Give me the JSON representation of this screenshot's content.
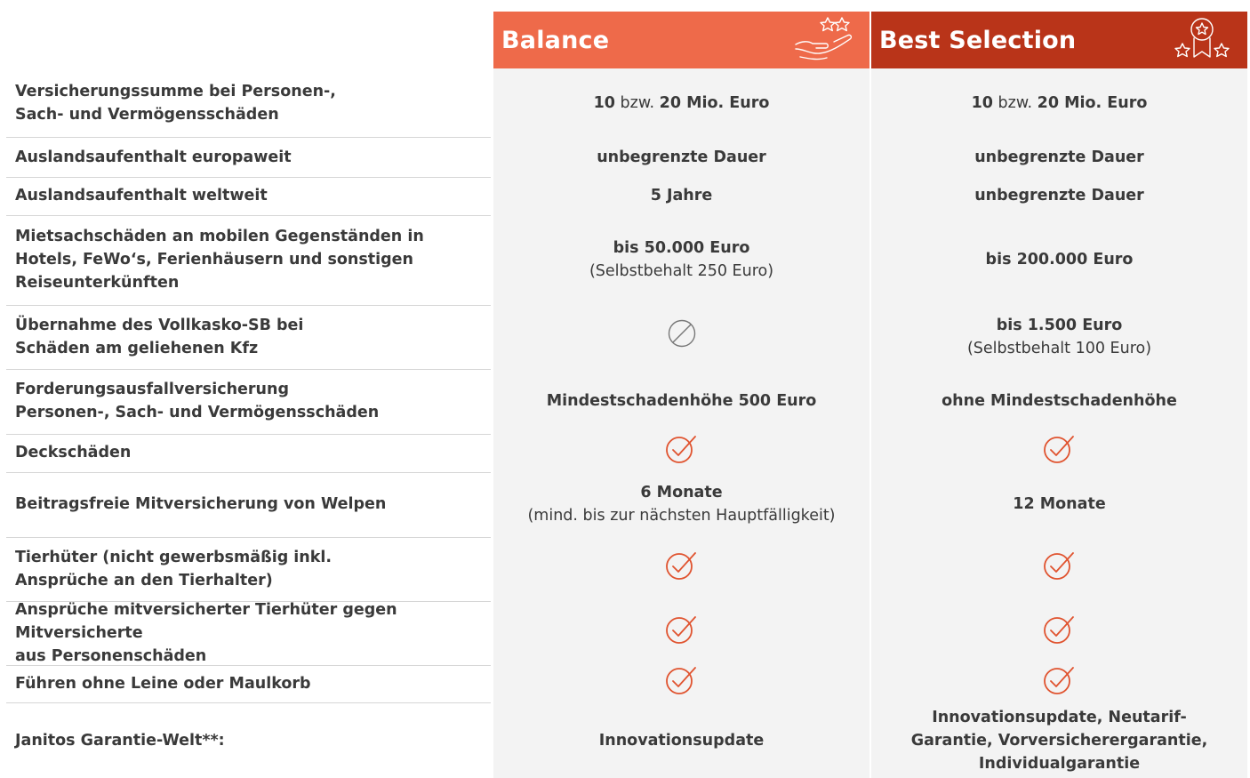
{
  "header": {
    "balance": {
      "title": "Balance",
      "color": "#ee6a4a",
      "icon": "hand-stars-icon"
    },
    "best": {
      "title": "Best Selection",
      "color": "#b93419",
      "icon": "award-stars-icon"
    }
  },
  "rows": [
    {
      "label": "Versicherungssumme bei Personen-,\nSach- und Vermögensschäden",
      "balance": {
        "n1": "10",
        "mid": " bzw. ",
        "n2": "20 Mio. Euro"
      },
      "best": {
        "n1": "10",
        "mid": " bzw. ",
        "n2": "20 Mio. Euro"
      }
    },
    {
      "label": "Auslandsaufenthalt europaweit",
      "balance": {
        "text": "unbegrenzte Dauer"
      },
      "best": {
        "text": "unbegrenzte Dauer"
      }
    },
    {
      "label": "Auslandsaufenthalt weltweit",
      "balance": {
        "text": "5 Jahre"
      },
      "best": {
        "text": "unbegrenzte Dauer"
      }
    },
    {
      "label": "Mietsachschäden an mobilen Gegenständen in\nHotels, FeWo‘s, Ferienhäusern und sonstigen\nReiseunterkünften",
      "balance": {
        "text": "bis 50.000 Euro",
        "sub": "(Selbstbehalt 250 Euro)"
      },
      "best": {
        "text": "bis 200.000 Euro"
      }
    },
    {
      "label": "Übernahme des Vollkasko-SB bei\nSchäden am geliehenen Kfz",
      "balance": {
        "icon": "not-included-icon"
      },
      "best": {
        "text": "bis 1.500 Euro",
        "sub": "(Selbstbehalt 100 Euro)"
      }
    },
    {
      "label": "Forderungsausfallversicherung\nPersonen-, Sach- und Vermögensschäden",
      "balance": {
        "text": "Mindestschadenhöhe 500 Euro"
      },
      "best": {
        "text": "ohne Mindestschadenhöhe"
      }
    },
    {
      "label": "Deckschäden",
      "balance": {
        "icon": "check-icon"
      },
      "best": {
        "icon": "check-icon"
      }
    },
    {
      "label": "Beitragsfreie Mitversicherung von Welpen",
      "balance": {
        "text": "6 Monate",
        "sub": "(mind. bis zur nächsten Hauptfälligkeit)"
      },
      "best": {
        "text": "12 Monate"
      }
    },
    {
      "label": "Tierhüter (nicht gewerbsmäßig inkl.\nAnsprüche an den Tierhalter)",
      "balance": {
        "icon": "check-icon"
      },
      "best": {
        "icon": "check-icon"
      }
    },
    {
      "label": "Ansprüche mitversicherter Tierhüter gegen Mitversicherte\naus Personenschäden",
      "balance": {
        "icon": "check-icon"
      },
      "best": {
        "icon": "check-icon"
      }
    },
    {
      "label": "Führen ohne Leine oder Maulkorb",
      "balance": {
        "icon": "check-icon"
      },
      "best": {
        "icon": "check-icon"
      }
    },
    {
      "label": "Janitos Garantie-Welt**:",
      "balance": {
        "text": "Innovationsupdate"
      },
      "best": {
        "text": "Innovationsupdate, Neutarif-\nGarantie, Vorversicherergarantie,\nIndividualgarantie"
      }
    }
  ],
  "colors": {
    "accent": "#ee6a4a",
    "icon": "#e0532f",
    "disabled": "#777777"
  }
}
